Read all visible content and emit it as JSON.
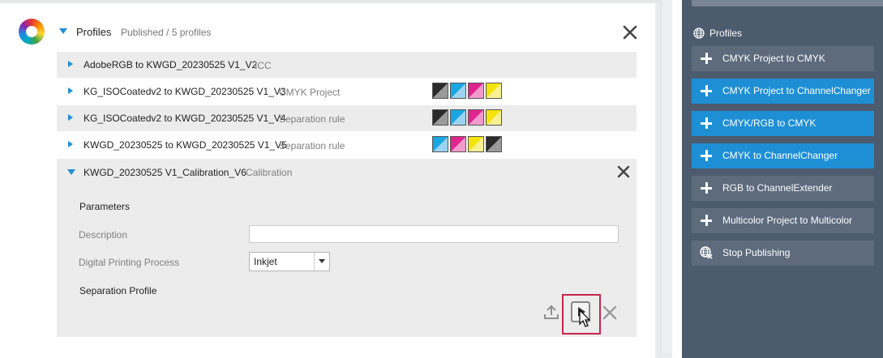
{
  "header": {
    "title": "Profiles",
    "subtitle": "Published / 5 profiles"
  },
  "rows": [
    {
      "name": "AdobeRGB to KWGD_20230525 V1_V2",
      "type": "ICC",
      "swatches": []
    },
    {
      "name": "KG_ISOCoatedv2 to KWGD_20230525 V1_V3",
      "type": "CMYK Project",
      "swatches": [
        [
          "#2b2b2b",
          "#9a9a9a"
        ],
        [
          "#19a6e3",
          "#9bd3f1"
        ],
        [
          "#e0258f",
          "#f19bcb"
        ],
        [
          "#f5e40c",
          "#f8f092"
        ]
      ]
    },
    {
      "name": "KG_ISOCoatedv2 to KWGD_20230525 V1_V4",
      "type": "Separation rule",
      "swatches": [
        [
          "#2b2b2b",
          "#9a9a9a"
        ],
        [
          "#19a6e3",
          "#9bd3f1"
        ],
        [
          "#e0258f",
          "#f19bcb"
        ],
        [
          "#f5e40c",
          "#f8f092"
        ]
      ]
    },
    {
      "name": "KWGD_20230525 to KWGD_20230525 V1_V5",
      "type": "Separation rule",
      "swatches": [
        [
          "#19a6e3",
          "#9bd3f1"
        ],
        [
          "#e0258f",
          "#f19bcb"
        ],
        [
          "#f5e40c",
          "#f8f092"
        ],
        [
          "#2b2b2b",
          "#9a9a9a"
        ]
      ]
    }
  ],
  "expanded": {
    "name": "KWGD_20230525 V1_Calibration_V6",
    "type": "Calibration",
    "parameters_label": "Parameters",
    "description_label": "Description",
    "description_value": "",
    "process_label": "Digital Printing Process",
    "process_value": "Inkjet",
    "separation_label": "Separation Profile"
  },
  "sidebar": {
    "title": "Profiles",
    "buttons": [
      {
        "label": "CMYK Project to CMYK",
        "style": "gray"
      },
      {
        "label": "CMYK Project to ChannelChanger",
        "style": "blue"
      },
      {
        "label": "CMYK/RGB to CMYK",
        "style": "blue"
      },
      {
        "label": "CMYK to ChannelChanger",
        "style": "blue"
      },
      {
        "label": "RGB to ChannelExtender",
        "style": "gray"
      },
      {
        "label": "Multicolor Project to Multicolor",
        "style": "gray"
      },
      {
        "label": "Stop Publishing",
        "style": "gray",
        "icon": "globe-icon"
      }
    ]
  },
  "colors": {
    "accent": "#1e8fd5",
    "sidebar_bg": "#4d5b6e",
    "highlight": "#c5264c"
  }
}
